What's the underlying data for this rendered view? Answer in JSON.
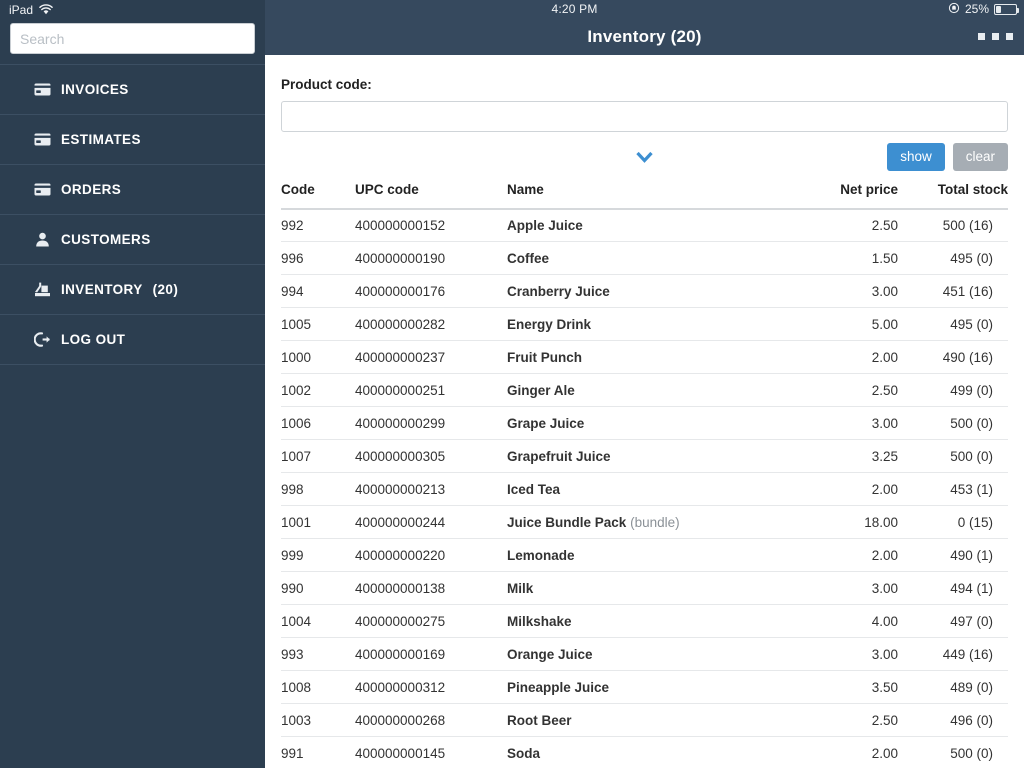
{
  "status_bar": {
    "device": "iPad",
    "wifi_icon": "wifi-icon",
    "time": "4:20 PM",
    "rotation_lock_icon": "rotation-lock-icon",
    "battery_percent": "25%",
    "battery_level": 25
  },
  "sidebar": {
    "search": {
      "value": "",
      "placeholder": "Search"
    },
    "items": [
      {
        "label": "INVOICES",
        "icon": "card-icon",
        "count": "",
        "active": false
      },
      {
        "label": "ESTIMATES",
        "icon": "card-icon",
        "count": "",
        "active": false
      },
      {
        "label": "ORDERS",
        "icon": "card-icon",
        "count": "",
        "active": false
      },
      {
        "label": "CUSTOMERS",
        "icon": "person-icon",
        "count": "",
        "active": false
      },
      {
        "label": "INVENTORY",
        "icon": "inventory-icon",
        "count": "(20)",
        "active": true
      },
      {
        "label": "LOG OUT",
        "icon": "logout-icon",
        "count": "",
        "active": false
      }
    ]
  },
  "topbar": {
    "title": "Inventory (20)",
    "menu_icon": "overflow-menu-icon"
  },
  "form": {
    "product_code_label": "Product code:",
    "product_code_value": "",
    "product_code_placeholder": "",
    "expand_icon": "chevron-down-icon",
    "show_label": "show",
    "clear_label": "clear"
  },
  "colors": {
    "sidebar_bg": "#2c3e50",
    "topbar_bg": "#36495e",
    "accent_blue": "#3d8fd1",
    "clear_gray": "#a6adb4"
  },
  "table": {
    "columns": [
      "Code",
      "UPC code",
      "Name",
      "Net price",
      "Total stock"
    ],
    "rows": [
      {
        "code": "992",
        "upc": "400000000152",
        "name": "Apple Juice",
        "name_sub": "",
        "price": "2.50",
        "stock": "500 (16)"
      },
      {
        "code": "996",
        "upc": "400000000190",
        "name": "Coffee",
        "name_sub": "",
        "price": "1.50",
        "stock": "495 (0)"
      },
      {
        "code": "994",
        "upc": "400000000176",
        "name": "Cranberry Juice",
        "name_sub": "",
        "price": "3.00",
        "stock": "451 (16)"
      },
      {
        "code": "1005",
        "upc": "400000000282",
        "name": "Energy Drink",
        "name_sub": "",
        "price": "5.00",
        "stock": "495 (0)"
      },
      {
        "code": "1000",
        "upc": "400000000237",
        "name": "Fruit Punch",
        "name_sub": "",
        "price": "2.00",
        "stock": "490 (16)"
      },
      {
        "code": "1002",
        "upc": "400000000251",
        "name": "Ginger Ale",
        "name_sub": "",
        "price": "2.50",
        "stock": "499 (0)"
      },
      {
        "code": "1006",
        "upc": "400000000299",
        "name": "Grape Juice",
        "name_sub": "",
        "price": "3.00",
        "stock": "500 (0)"
      },
      {
        "code": "1007",
        "upc": "400000000305",
        "name": "Grapefruit Juice",
        "name_sub": "",
        "price": "3.25",
        "stock": "500 (0)"
      },
      {
        "code": "998",
        "upc": "400000000213",
        "name": "Iced Tea",
        "name_sub": "",
        "price": "2.00",
        "stock": "453 (1)"
      },
      {
        "code": "1001",
        "upc": "400000000244",
        "name": "Juice Bundle Pack",
        "name_sub": "(bundle)",
        "price": "18.00",
        "stock": "0 (15)"
      },
      {
        "code": "999",
        "upc": "400000000220",
        "name": "Lemonade",
        "name_sub": "",
        "price": "2.00",
        "stock": "490 (1)"
      },
      {
        "code": "990",
        "upc": "400000000138",
        "name": "Milk",
        "name_sub": "",
        "price": "3.00",
        "stock": "494 (1)"
      },
      {
        "code": "1004",
        "upc": "400000000275",
        "name": "Milkshake",
        "name_sub": "",
        "price": "4.00",
        "stock": "497 (0)"
      },
      {
        "code": "993",
        "upc": "400000000169",
        "name": "Orange Juice",
        "name_sub": "",
        "price": "3.00",
        "stock": "449 (16)"
      },
      {
        "code": "1008",
        "upc": "400000000312",
        "name": "Pineapple Juice",
        "name_sub": "",
        "price": "3.50",
        "stock": "489 (0)"
      },
      {
        "code": "1003",
        "upc": "400000000268",
        "name": "Root Beer",
        "name_sub": "",
        "price": "2.50",
        "stock": "496 (0)"
      },
      {
        "code": "991",
        "upc": "400000000145",
        "name": "Soda",
        "name_sub": "",
        "price": "2.00",
        "stock": "500 (0)"
      }
    ]
  }
}
